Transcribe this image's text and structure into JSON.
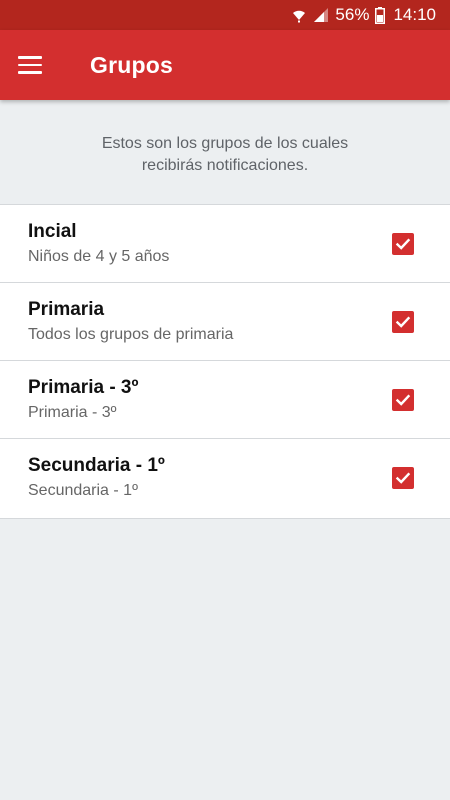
{
  "status_bar": {
    "battery": "56%",
    "time": "14:10",
    "icons": [
      "wifi-icon",
      "signal-icon",
      "battery-icon"
    ]
  },
  "app_bar": {
    "title": "Grupos",
    "menu_icon": "hamburger-menu-icon"
  },
  "intro_text": "Estos son los grupos de los cuales recibirás notificaciones.",
  "groups": [
    {
      "name": "Incial",
      "description": "Niños de 4 y 5 años",
      "checked": true
    },
    {
      "name": "Primaria",
      "description": "Todos los grupos de primaria",
      "checked": true
    },
    {
      "name": "Primaria - 3º",
      "description": "Primaria - 3º",
      "checked": true
    },
    {
      "name": "Secundaria - 1º",
      "description": "Secundaria - 1º",
      "checked": true
    }
  ],
  "colors": {
    "primary": "#d32f2f",
    "status_bar": "#b3261e",
    "background": "#eceff1"
  }
}
